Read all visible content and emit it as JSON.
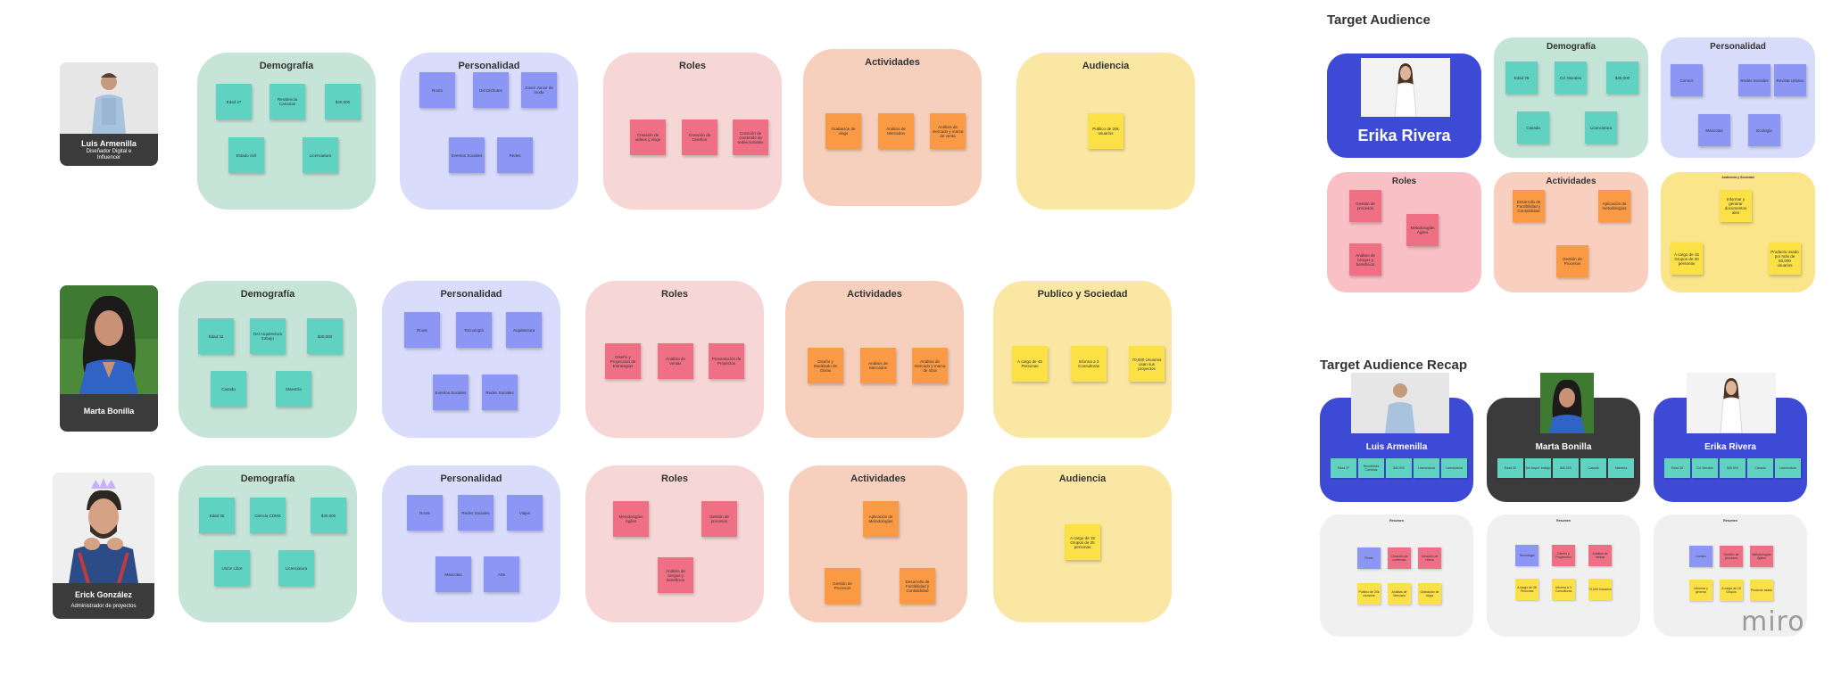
{
  "brand": {
    "logo_text": "miro"
  },
  "row1": {
    "person": {
      "name": "Luis Armenilla",
      "role": "Diseñador Digital e Influencer"
    },
    "frames": [
      {
        "title": "Demografía",
        "notes": [
          "Edad 27",
          "Residencia Canarias",
          "$40,000",
          "Estado civil",
          "Licenciatura"
        ]
      },
      {
        "title": "Personalidad",
        "notes": [
          "Roots",
          "Del Disfrutes",
          "Joven Junior de moda",
          "Eventos Sociales",
          "Redes"
        ]
      },
      {
        "title": "Roles",
        "notes": [
          "Creación de videos y vlogs",
          "Creación de Diseños",
          "Creación de contenido de redes sociales"
        ]
      },
      {
        "title": "Actividades",
        "notes": [
          "Grabación de vlogs",
          "Análisis de Mercados",
          "Análisis de mercado y marca de venta"
        ]
      },
      {
        "title": "Audiencia",
        "notes": [
          "Publico de 20k usuarios"
        ]
      }
    ]
  },
  "row2": {
    "person": {
      "name": "Marta Bonilla"
    },
    "frames": [
      {
        "title": "Demografía",
        "notes": [
          "Edad 32",
          "Del Arquitectura trabajo",
          "$40,000",
          "Casada",
          "Maestría"
        ]
      },
      {
        "title": "Personalidad",
        "notes": [
          "Roots",
          "Tecnología",
          "Arquitectura",
          "Eventos Sociales",
          "Redes Sociales"
        ]
      },
      {
        "title": "Roles",
        "notes": [
          "Diseño y Proyección de Estrategias",
          "Análisis de ventas",
          "Presentación de Proyectos"
        ]
      },
      {
        "title": "Actividades",
        "notes": [
          "Diseño y Modelado de Obras",
          "Análisis de Mercados",
          "Análisis de mercado y marca de obra"
        ]
      },
      {
        "title": "Publico y Sociedad",
        "notes": [
          "A cargo de 45 Personas",
          "Informa a 3 Consultoras",
          "70,000 Usuarios usan sus proyectos"
        ]
      }
    ]
  },
  "row3": {
    "person": {
      "name": "Erick González",
      "role": "Administrador de proyectos"
    },
    "frames": [
      {
        "title": "Demografía",
        "notes": [
          "Edad 35",
          "Ciencia CDMX",
          "$30,000",
          "Unión Libre",
          "Licenciatura"
        ]
      },
      {
        "title": "Personalidad",
        "notes": [
          "Roots",
          "Redes Sociales",
          "Viajes",
          "Mascotas",
          "Arte"
        ]
      },
      {
        "title": "Roles",
        "notes": [
          "Metodologías Ágiles",
          "Gestión de procesos",
          "Análisis de riesgos y beneficios"
        ]
      },
      {
        "title": "Actividades",
        "notes": [
          "Aplicación de Metodologías",
          "Gestión de Procesos",
          "Desarrollo de Factibilidad y Contabilidad"
        ]
      },
      {
        "title": "Audiencia",
        "notes": [
          "A cargo de 15 Grupos de 25 personas"
        ]
      }
    ]
  },
  "target": {
    "title": "Target Audience",
    "person_name": "Erika Rivera",
    "frames": [
      {
        "title": "Demografía",
        "notes": [
          "Edad 28",
          "Cd. Morales",
          "$45,000",
          "Casada",
          "Licenciatura"
        ]
      },
      {
        "title": "Personalidad",
        "notes": [
          "Comics",
          "Redes Sociales",
          "Revista Urbano",
          "Mascotas",
          "Ecología"
        ]
      },
      {
        "title": "Roles",
        "notes": [
          "Gestión de procesos",
          "Metodologías Ágiles",
          "Análisis de riesgos y beneficios"
        ]
      },
      {
        "title": "Actividades",
        "notes": [
          "Desarrollo de Factibilidad y Contabilidad",
          "Aplicación de metodologías",
          "Gestión de Procesos"
        ]
      },
      {
        "title": "Audiencia y Sociedad",
        "notes": [
          "Informar y generar documentos ales",
          "A cargo de 15 Grupos de 30 personas",
          "Producto usado por más de 60,000 usuarios"
        ]
      }
    ]
  },
  "recap": {
    "title": "Target Audience Recap",
    "cards": [
      {
        "name": "Luis Armenilla",
        "notes": [
          "Edad 27",
          "Residencia Canarias",
          "$40,000",
          "Licenciatura",
          "Licenciatura"
        ]
      },
      {
        "name": "Marta Bonilla",
        "notes": [
          "Edad 32",
          "Del Arquit. trabajo",
          "$40,000",
          "Casada",
          "Maestría"
        ]
      },
      {
        "name": "Erika Rivera",
        "notes": [
          "Edad 28",
          "Cd. Morales",
          "$45,000",
          "Casada",
          "Licenciatura"
        ]
      }
    ],
    "mini": [
      {
        "title": "Resumen",
        "notes": [
          "Roots",
          "Creación de contenido",
          "Creación de videos",
          "Publico de 20k usuarios",
          "Análisis de Mercado",
          "Grabación de vlogs"
        ]
      },
      {
        "title": "Resumen",
        "notes": [
          "Tecnología",
          "Diseño y Proyección",
          "Análisis de ventas",
          "A cargo de 45 Personas",
          "Informa a 3 Consultoras",
          "70,000 Usuarios"
        ]
      },
      {
        "title": "Resumen",
        "notes": [
          "Comics",
          "Gestión de procesos",
          "Metodologías Ágiles",
          "Informar y generar",
          "A cargo de 15 Grupos",
          "Producto usado"
        ]
      }
    ]
  }
}
